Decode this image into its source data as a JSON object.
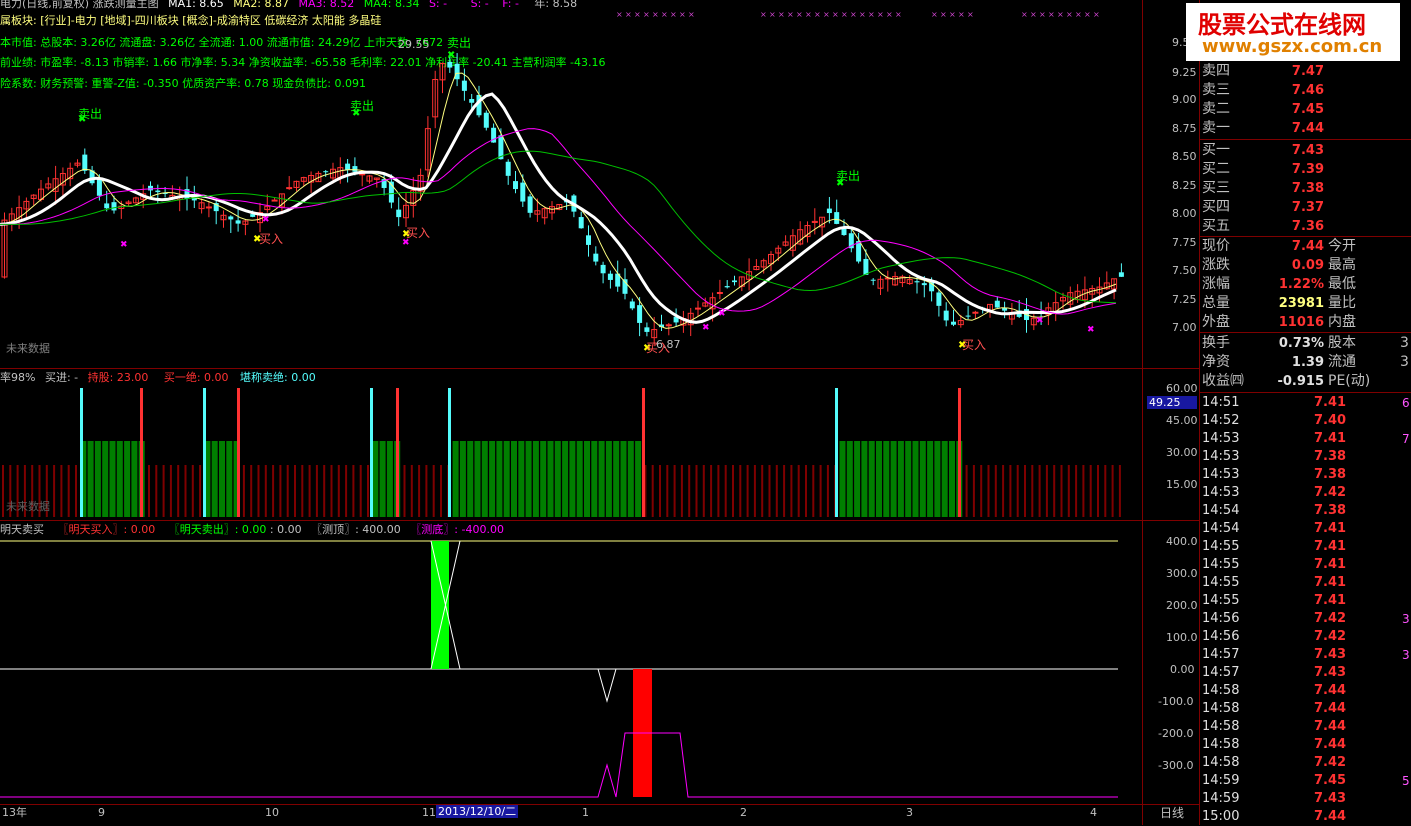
{
  "header": {
    "title": "电力(日线,前复权) 涨跌测量主图",
    "ma1": "MA1: 8.65",
    "ma2": "MA2: 8.87",
    "ma3": "MA3: 8.52",
    "ma4": "MA4: 8.34",
    "s_mark": "S: -",
    "s2_mark": "S: -",
    "f_mark": "F: -",
    "year": "年: 8.58"
  },
  "info_lines": [
    "属板块: [行业]-电力 [地域]-四川板块 [概念]-成渝特区 低碳经济 太阳能 多晶硅",
    "本市值: 总股本: 3.26亿 流通盘: 3.26亿 全流通: 1.00 流通市值: 24.29亿 上市天数: 7672",
    "前业绩: 市盈率: -8.13 市销率: 1.66 市净率: 5.34 净资收益率: -65.58 毛利率: 22.01 净利润率 -20.41 主营利润率 -43.16",
    "险系数: 财务预警: 重警-Z值: -0.350 优质资产率: 0.78 现金负债比: 0.091"
  ],
  "main_chart": {
    "price_ticks": [
      "9.50",
      "9.25",
      "9.00",
      "8.75",
      "8.50",
      "8.25",
      "8.00",
      "7.75",
      "7.50",
      "7.25",
      "7.00"
    ],
    "annotations": {
      "sell1": "卖出",
      "sell2": "卖出",
      "sell3": "卖出",
      "sell4": "卖出",
      "buy1": "买入",
      "buy2": "买入",
      "buy3": "买入",
      "buy4": "买入",
      "high_price": "29.55",
      "low_price": "6.87"
    },
    "future_data_label": "未来数据"
  },
  "sub1": {
    "label_rate": "率98%",
    "label_buy": "买进: -",
    "label_hold": "持股: 23.00",
    "label_buyone": "买一绝: 0.00",
    "label_sell": "堪称卖绝: 0.00",
    "ticks": [
      "60.00",
      "45.00",
      "30.00",
      "15.00"
    ],
    "current_value": "49.25",
    "future_label": "未来数据"
  },
  "sub2": {
    "title": "明天卖买",
    "buy": "〖明天买入〗: 0.00",
    "sell": "〖明天卖出〗: 0.00",
    "sell_val": ": 0.00",
    "top": "〖测顶〗: 400.00",
    "bottom": "〖测底〗: -400.00",
    "ticks": [
      "400.0",
      "300.0",
      "200.0",
      "100.0",
      "0.00",
      "-100.0",
      "-200.0",
      "-300.0"
    ]
  },
  "x_axis": {
    "labels": [
      "13年",
      "9",
      "10",
      "11",
      "1",
      "2",
      "3",
      "4"
    ],
    "cursor_date": "2013/12/10/二",
    "period": "日线"
  },
  "watermark": {
    "line1": "股票公式在线网",
    "line2": "www.gszx.com.cn"
  },
  "order_book": {
    "asks": [
      {
        "label": "卖四",
        "price": "7.47"
      },
      {
        "label": "卖三",
        "price": "7.46"
      },
      {
        "label": "卖二",
        "price": "7.45"
      },
      {
        "label": "卖一",
        "price": "7.44"
      }
    ],
    "bids": [
      {
        "label": "买一",
        "price": "7.43"
      },
      {
        "label": "买二",
        "price": "7.39"
      },
      {
        "label": "买三",
        "price": "7.38"
      },
      {
        "label": "买四",
        "price": "7.37"
      },
      {
        "label": "买五",
        "price": "7.36"
      }
    ]
  },
  "stats": [
    {
      "label": "现价",
      "value": "7.44",
      "label2": "今开"
    },
    {
      "label": "涨跌",
      "value": "0.09",
      "label2": "最高"
    },
    {
      "label": "涨幅",
      "value": "1.22%",
      "label2": "最低"
    },
    {
      "label": "总量",
      "value": "23981",
      "label2": "量比"
    },
    {
      "label": "外盘",
      "value": "11016",
      "label2": "内盘"
    },
    {
      "label": "换手",
      "value": "0.73%",
      "label2": "股本",
      "value2": "3"
    },
    {
      "label": "净资",
      "value": "1.39",
      "label2": "流通",
      "value2": "3"
    },
    {
      "label": "收益㈣",
      "value": "-0.915",
      "label2": "PE(动)"
    }
  ],
  "ticks": [
    {
      "time": "14:51",
      "price": "7.41",
      "vol": "6"
    },
    {
      "time": "14:52",
      "price": "7.40",
      "vol": ""
    },
    {
      "time": "14:53",
      "price": "7.41",
      "vol": "7"
    },
    {
      "time": "14:53",
      "price": "7.38",
      "vol": ""
    },
    {
      "time": "14:53",
      "price": "7.38",
      "vol": ""
    },
    {
      "time": "14:53",
      "price": "7.42",
      "vol": ""
    },
    {
      "time": "14:54",
      "price": "7.38",
      "vol": ""
    },
    {
      "time": "14:54",
      "price": "7.41",
      "vol": ""
    },
    {
      "time": "14:55",
      "price": "7.41",
      "vol": ""
    },
    {
      "time": "14:55",
      "price": "7.41",
      "vol": ""
    },
    {
      "time": "14:55",
      "price": "7.41",
      "vol": ""
    },
    {
      "time": "14:55",
      "price": "7.41",
      "vol": ""
    },
    {
      "time": "14:56",
      "price": "7.42",
      "vol": "3"
    },
    {
      "time": "14:56",
      "price": "7.42",
      "vol": ""
    },
    {
      "time": "14:57",
      "price": "7.43",
      "vol": "3"
    },
    {
      "time": "14:57",
      "price": "7.43",
      "vol": ""
    },
    {
      "time": "14:58",
      "price": "7.44",
      "vol": ""
    },
    {
      "time": "14:58",
      "price": "7.44",
      "vol": ""
    },
    {
      "time": "14:58",
      "price": "7.44",
      "vol": ""
    },
    {
      "time": "14:58",
      "price": "7.44",
      "vol": ""
    },
    {
      "time": "14:58",
      "price": "7.42",
      "vol": ""
    },
    {
      "time": "14:59",
      "price": "7.45",
      "vol": "5"
    },
    {
      "time": "14:59",
      "price": "7.43",
      "vol": ""
    },
    {
      "time": "15:00",
      "price": "7.44",
      "vol": ""
    }
  ],
  "colors": {
    "grid": "#7f0000",
    "up": "#ff3232",
    "down": "#54fcfc",
    "ma_white": "#ffffff",
    "ma_yellow": "#ffff80",
    "ma_magenta": "#ff00ff",
    "ma_green": "#00c000",
    "bar_green": "#007f00",
    "bar_darkred": "#7f0000"
  }
}
